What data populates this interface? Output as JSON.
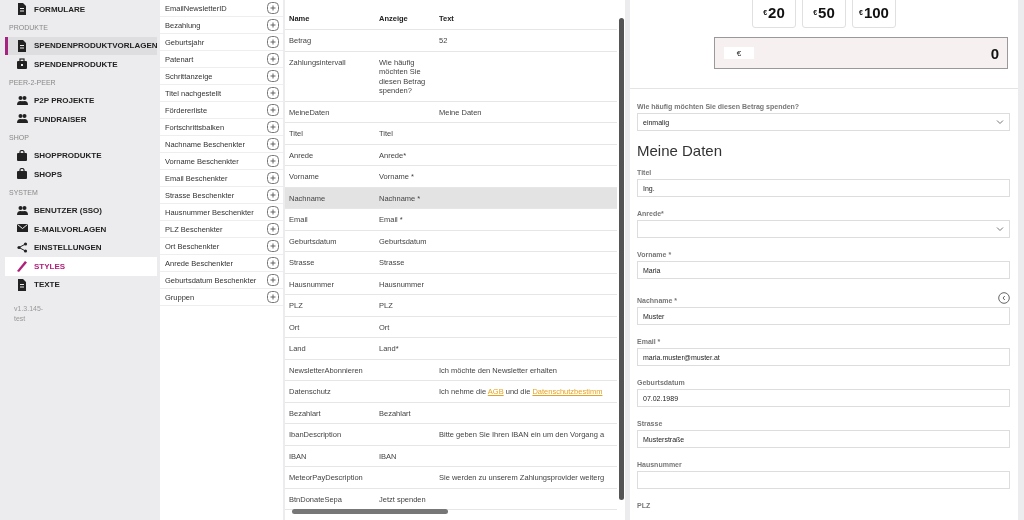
{
  "sidebar": {
    "items": [
      {
        "kind": "item",
        "label": "FORMULARE",
        "selected": false,
        "hovered": false
      },
      {
        "kind": "heading",
        "label": "PRODUKTE"
      },
      {
        "kind": "item",
        "label": "SPENDENPRODUKTVORLAGEN",
        "selected": true,
        "hovered": false
      },
      {
        "kind": "item",
        "label": "SPENDENPRODUKTE",
        "selected": false,
        "hovered": false
      },
      {
        "kind": "heading",
        "label": "PEER-2-PEER"
      },
      {
        "kind": "item",
        "label": "P2P PROJEKTE",
        "selected": false,
        "hovered": false
      },
      {
        "kind": "item",
        "label": "FUNDRAISER",
        "selected": false,
        "hovered": false
      },
      {
        "kind": "heading",
        "label": "SHOP"
      },
      {
        "kind": "item",
        "label": "SHOPPRODUKTE",
        "selected": false,
        "hovered": false
      },
      {
        "kind": "item",
        "label": "SHOPS",
        "selected": false,
        "hovered": false
      },
      {
        "kind": "heading",
        "label": "SYSTEM"
      },
      {
        "kind": "item",
        "label": "BENUTZER (SSO)",
        "selected": false,
        "hovered": false
      },
      {
        "kind": "item",
        "label": "E-MAILVORLAGEN",
        "selected": false,
        "hovered": false
      },
      {
        "kind": "item",
        "label": "EINSTELLUNGEN",
        "selected": false,
        "hovered": false
      },
      {
        "kind": "item",
        "label": "STYLES",
        "selected": false,
        "hovered": true
      },
      {
        "kind": "item",
        "label": "TEXTE",
        "selected": false,
        "hovered": false
      }
    ],
    "version": [
      "v1.3.145-",
      "test"
    ]
  },
  "fields": [
    "EmailNewsletterID",
    "Bezahlung",
    "Geburtsjahr",
    "Patenart",
    "Schrittanzeige",
    "Titel nachgestellt",
    "Fördererliste",
    "Fortschrittsbalken",
    "Nachname Beschenkter",
    "Vorname Beschenkter",
    "Email Beschenkter",
    "Strasse Beschenkter",
    "Hausnummer Beschenkter",
    "PLZ Beschenkter",
    "Ort Beschenkter",
    "Anrede Beschenkter",
    "Geburtsdatum Beschenkter",
    "Gruppen"
  ],
  "table": {
    "columns": [
      "Name",
      "Anzeige",
      "Text"
    ],
    "rows": [
      {
        "name": "Betrag",
        "text": "52",
        "selected": false
      },
      {
        "name": "Zahlungsintervall",
        "display": "Wie häufig möchten Sie diesen Betrag spenden?",
        "selected": false
      },
      {
        "name": "MeineDaten",
        "text": "Meine Daten",
        "selected": false
      },
      {
        "name": "Titel",
        "display": "Titel",
        "selected": false
      },
      {
        "name": "Anrede",
        "display": "Anrede*",
        "selected": false
      },
      {
        "name": "Vorname",
        "display": "Vorname *",
        "selected": false
      },
      {
        "name": "Nachname",
        "display": "Nachname *",
        "selected": true
      },
      {
        "name": "Email",
        "display": "Email *",
        "selected": false
      },
      {
        "name": "Geburtsdatum",
        "display": "Geburtsdatum",
        "selected": false
      },
      {
        "name": "Strasse",
        "display": "Strasse",
        "selected": false
      },
      {
        "name": "Hausnummer",
        "display": "Hausnummer",
        "selected": false
      },
      {
        "name": "PLZ",
        "display": "PLZ",
        "selected": false
      },
      {
        "name": "Ort",
        "display": "Ort",
        "selected": false
      },
      {
        "name": "Land",
        "display": "Land*",
        "selected": false
      },
      {
        "name": "NewsletterAbonnieren",
        "text": "Ich möchte den Newsletter erhalten",
        "selected": false
      },
      {
        "name": "Datenschutz",
        "text_parts": [
          {
            "kind": "plain",
            "text": "Ich nehme die "
          },
          {
            "kind": "link",
            "text": "AGB"
          },
          {
            "kind": "plain",
            "text": " und die "
          },
          {
            "kind": "link",
            "text": "Datenschutzbestimm"
          }
        ],
        "selected": false
      },
      {
        "name": "Bezahlart",
        "display": "Bezahlart",
        "selected": false
      },
      {
        "name": "IbanDescription",
        "text": "Bitte geben Sie Ihren IBAN ein um den Vorgang a",
        "selected": false
      },
      {
        "name": "IBAN",
        "display": "IBAN",
        "selected": false
      },
      {
        "name": "MeteorPayDescription",
        "text": "Sie werden zu unserem Zahlungsprovider weiterg",
        "selected": false
      },
      {
        "name": "BtnDonateSepa",
        "display": "Jetzt spenden",
        "selected": false
      }
    ]
  },
  "form": {
    "amount_options": [
      {
        "currency": "€",
        "value": "20"
      },
      {
        "currency": "€",
        "value": "50"
      },
      {
        "currency": "€",
        "value": "100"
      }
    ],
    "amount": {
      "currency": "€",
      "value": "0"
    },
    "frequency": {
      "label": "Wie häufig möchten Sie diesen Betrag spenden?",
      "value": "einmalig"
    },
    "section_title": "Meine Daten",
    "fields": [
      {
        "kind": "text",
        "label": "Titel",
        "value": "Ing.",
        "info": false
      },
      {
        "kind": "select",
        "label": "Anrede*",
        "info": false
      },
      {
        "kind": "text",
        "label": "Vorname *",
        "value": "Maria",
        "info": false
      },
      {
        "kind": "text",
        "label": "Nachname *",
        "value": "Muster",
        "info": true
      },
      {
        "kind": "text",
        "label": "Email *",
        "value": "maria.muster@muster.at",
        "info": false
      },
      {
        "kind": "text",
        "label": "Geburtsdatum",
        "value": "07.02.1989",
        "info": false
      },
      {
        "kind": "text",
        "label": "Strasse",
        "value": "Musterstraße",
        "info": false
      },
      {
        "kind": "text",
        "label": "Hausnummer",
        "info": false
      },
      {
        "kind": "label",
        "label": "PLZ",
        "info": false
      }
    ]
  }
}
